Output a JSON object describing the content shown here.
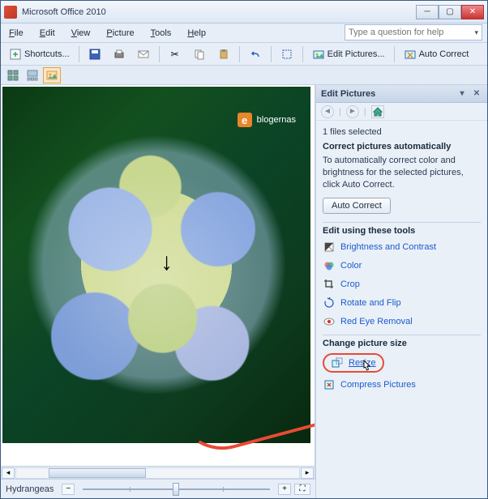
{
  "window": {
    "title": "Microsoft Office 2010"
  },
  "menu": {
    "file": "File",
    "edit": "Edit",
    "view": "View",
    "picture": "Picture",
    "tools": "Tools",
    "help": "Help"
  },
  "helpbox": {
    "placeholder": "Type a question for help"
  },
  "toolbar": {
    "shortcuts": "Shortcuts...",
    "edit_pictures": "Edit Pictures...",
    "auto_correct": "Auto Correct"
  },
  "image": {
    "filename": "Hydrangeas",
    "watermark": "blogernas"
  },
  "panel": {
    "title": "Edit Pictures",
    "selected": "1 files selected",
    "correct_heading": "Correct pictures automatically",
    "correct_note": "To automatically correct color and brightness for the selected pictures, click Auto Correct.",
    "auto_correct_btn": "Auto Correct",
    "tools_heading": "Edit using these tools",
    "tools": {
      "brightness": "Brightness and Contrast",
      "color": "Color",
      "crop": "Crop",
      "rotate": "Rotate and Flip",
      "redeye": "Red Eye Removal"
    },
    "size_heading": "Change picture size",
    "resize": "Resize",
    "compress": "Compress Pictures"
  }
}
